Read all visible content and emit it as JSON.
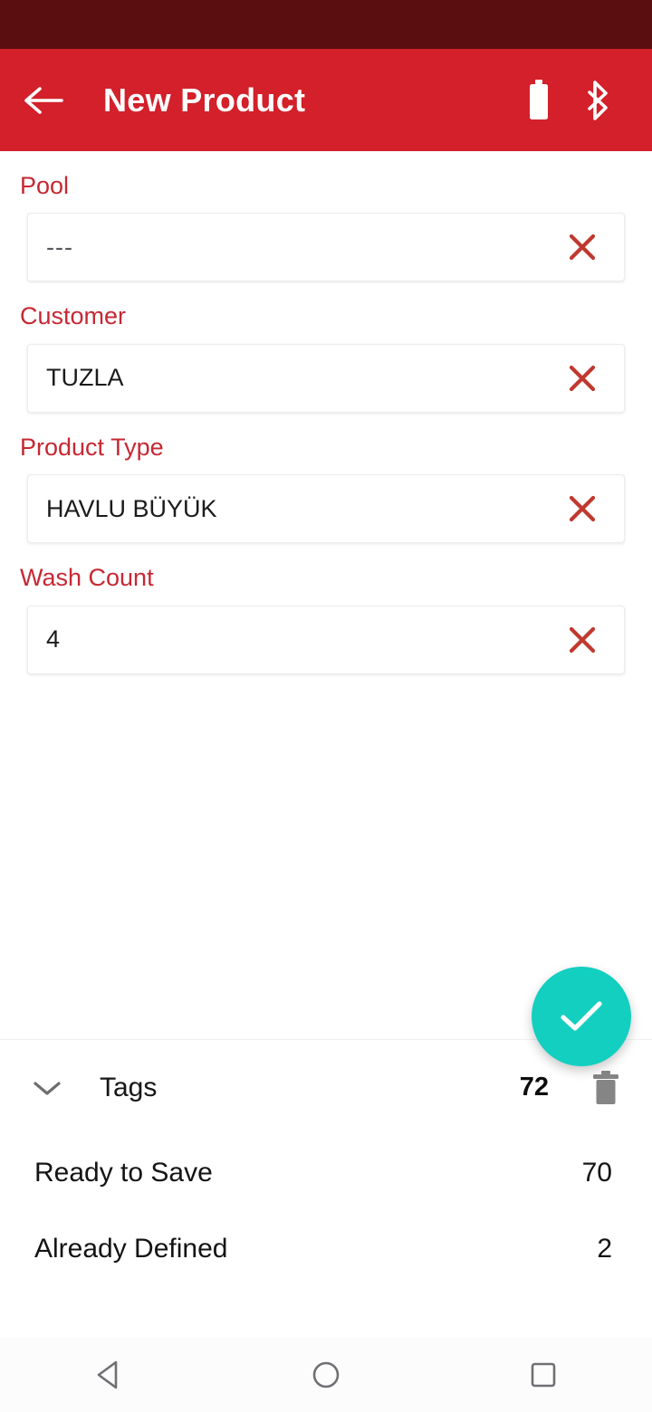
{
  "status_bar": {
    "background": "#5a0e10"
  },
  "app_bar": {
    "title": "New Product",
    "background": "#d3202a",
    "back_icon": "arrow-left-icon",
    "icons": [
      {
        "name": "battery-icon",
        "label": "Battery"
      },
      {
        "name": "bluetooth-icon",
        "label": "Bluetooth"
      }
    ]
  },
  "form": {
    "label_color": "#c62833",
    "fields": [
      {
        "label": "Pool",
        "value": "---",
        "is_placeholder": true,
        "clear_label": "Clear"
      },
      {
        "label": "Customer",
        "value": "TUZLA",
        "is_placeholder": false,
        "clear_label": "Clear"
      },
      {
        "label": "Product Type",
        "value": "HAVLU BÜYÜK",
        "is_placeholder": false,
        "clear_label": "Clear"
      },
      {
        "label": "Wash Count",
        "value": "4",
        "is_placeholder": false,
        "clear_label": "Clear"
      }
    ]
  },
  "fab": {
    "icon": "check-icon",
    "label": "Confirm",
    "color": "#13cfc0"
  },
  "bottom_sheet": {
    "tags": {
      "expand_icon": "chevron-down-icon",
      "label": "Tags",
      "count": "72",
      "delete_icon": "trash-icon"
    },
    "stats": [
      {
        "label": "Ready to Save",
        "value": "70"
      },
      {
        "label": "Already Defined",
        "value": "2"
      }
    ]
  },
  "nav_bar": {
    "buttons": [
      {
        "name": "back-nav-button",
        "icon": "triangle-back-icon"
      },
      {
        "name": "home-nav-button",
        "icon": "circle-home-icon"
      },
      {
        "name": "recents-nav-button",
        "icon": "square-recents-icon"
      }
    ]
  }
}
